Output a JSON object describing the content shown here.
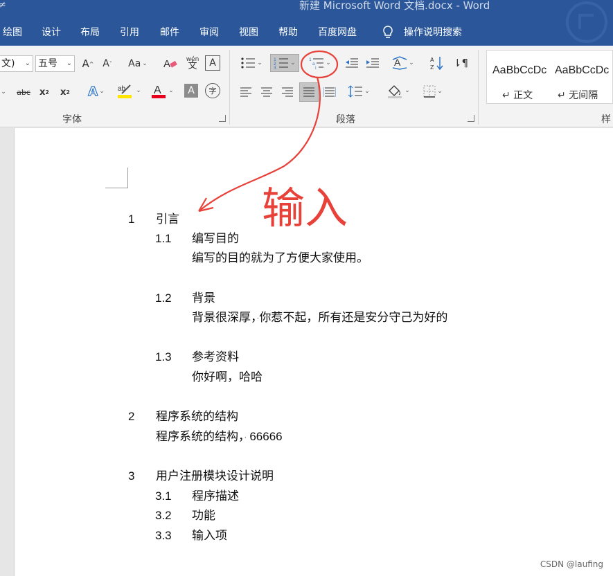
{
  "title": {
    "fragment": "≠",
    "text": "新建 Microsoft Word 文档.docx  -  Word"
  },
  "menu": [
    "绘图",
    "设计",
    "布局",
    "引用",
    "邮件",
    "审阅",
    "视图",
    "帮助",
    "百度网盘",
    "操作说明搜索"
  ],
  "font": {
    "name_value": "文)",
    "size_value": "五号",
    "group_label": "字体"
  },
  "paragraph": {
    "group_label": "段落"
  },
  "styles": {
    "items": [
      {
        "sample": "AaBbCcDc",
        "name": "↵ 正文"
      },
      {
        "sample": "AaBbCcDc",
        "name": "↵ 无间隔"
      }
    ],
    "group_label": "样"
  },
  "document": {
    "lines": [
      {
        "num": "1",
        "text": "引言"
      },
      {
        "num": "1.1",
        "text": "编写目的"
      },
      {
        "num": "",
        "text": "编写的目的就为了方便大家使用。"
      },
      {
        "num": "1.2",
        "text": "背景"
      },
      {
        "num": "",
        "text_a": "背景很深厚，",
        "mark": "·",
        "text_b": "你惹不起，所有还是安分守己为好的"
      },
      {
        "num": "1.3",
        "text": "参考资料"
      },
      {
        "num": "",
        "text": "你好啊，哈哈"
      },
      {
        "num": "2",
        "text": "程序系统的结构"
      },
      {
        "num": "",
        "text_a": "程序系统的结构，",
        "mark": "·",
        "text_b": "66666"
      },
      {
        "num": "3",
        "text": "用户注册模块设计说明"
      },
      {
        "num": "3.1",
        "text": "程序描述"
      },
      {
        "num": "3.2",
        "text": "功能"
      },
      {
        "num": "3.3",
        "text": "输入项"
      }
    ]
  },
  "annotation": {
    "text": "输入",
    "color": "#e8413a"
  },
  "credit": "CSDN @laufing"
}
